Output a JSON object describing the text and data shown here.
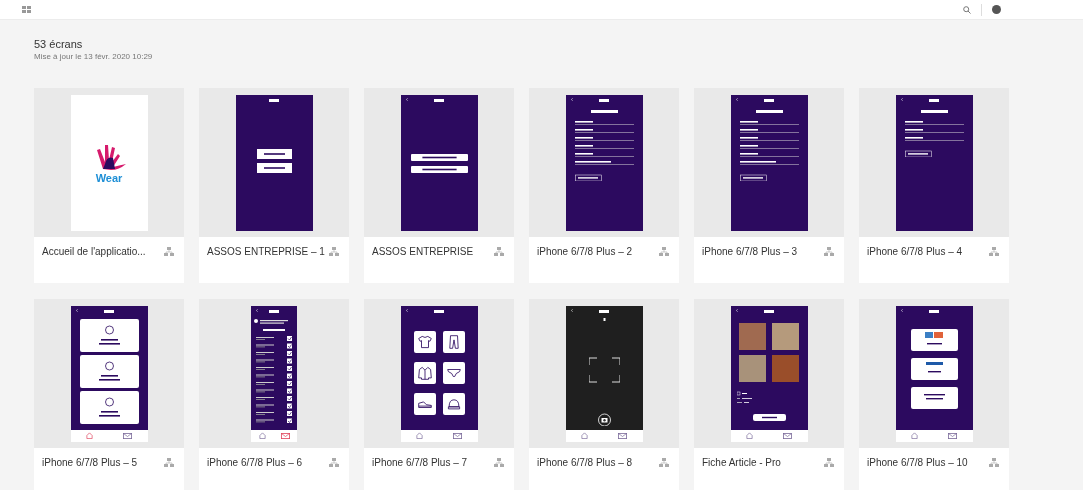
{
  "header": {
    "count": "53 écrans",
    "updated": "Mise à jour le 13 févr. 2020 10:29"
  },
  "screens": [
    {
      "name": "Accueil de l'applicatio...",
      "preview": {
        "kind": "splash",
        "logo": "Wear"
      }
    },
    {
      "name": "ASSOS ENTREPRISE – 1",
      "preview": {
        "kind": "account-type",
        "back": false
      }
    },
    {
      "name": "ASSOS ENTREPRISE",
      "preview": {
        "kind": "auth-choice",
        "back": true
      }
    },
    {
      "name": "iPhone 6/7/8 Plus – 2",
      "preview": {
        "kind": "signup",
        "back": true
      }
    },
    {
      "name": "iPhone 6/7/8 Plus – 3",
      "preview": {
        "kind": "signup",
        "back": true
      }
    },
    {
      "name": "iPhone 6/7/8 Plus – 4",
      "preview": {
        "kind": "login",
        "back": true
      }
    },
    {
      "name": "iPhone 6/7/8 Plus – 5",
      "preview": {
        "kind": "menu",
        "back": true,
        "nav": [
          {
            "kind": "home",
            "selected": true
          },
          {
            "kind": "mail",
            "selected": false
          }
        ]
      }
    },
    {
      "name": "iPhone 6/7/8 Plus – 6",
      "preview": {
        "kind": "notifications",
        "back": true,
        "nav": [
          {
            "kind": "home",
            "selected": false
          },
          {
            "kind": "mail",
            "selected": true
          }
        ]
      }
    },
    {
      "name": "iPhone 6/7/8 Plus – 7",
      "preview": {
        "kind": "grid",
        "back": true,
        "nav": [
          {
            "kind": "home",
            "selected": false
          },
          {
            "kind": "mail",
            "selected": false
          }
        ]
      }
    },
    {
      "name": "iPhone 6/7/8 Plus – 8",
      "preview": {
        "kind": "camera",
        "back": true,
        "nav": [
          {
            "kind": "home",
            "selected": false
          },
          {
            "kind": "mail",
            "selected": false
          }
        ]
      }
    },
    {
      "name": "Fiche Article - Pro",
      "preview": {
        "kind": "article",
        "back": true,
        "nav": [
          {
            "kind": "home",
            "selected": false
          },
          {
            "kind": "mail",
            "selected": false
          }
        ]
      }
    },
    {
      "name": "iPhone 6/7/8 Plus – 10",
      "preview": {
        "kind": "payment",
        "back": true,
        "nav": [
          {
            "kind": "home",
            "selected": false
          },
          {
            "kind": "mail",
            "selected": false
          }
        ]
      }
    }
  ]
}
